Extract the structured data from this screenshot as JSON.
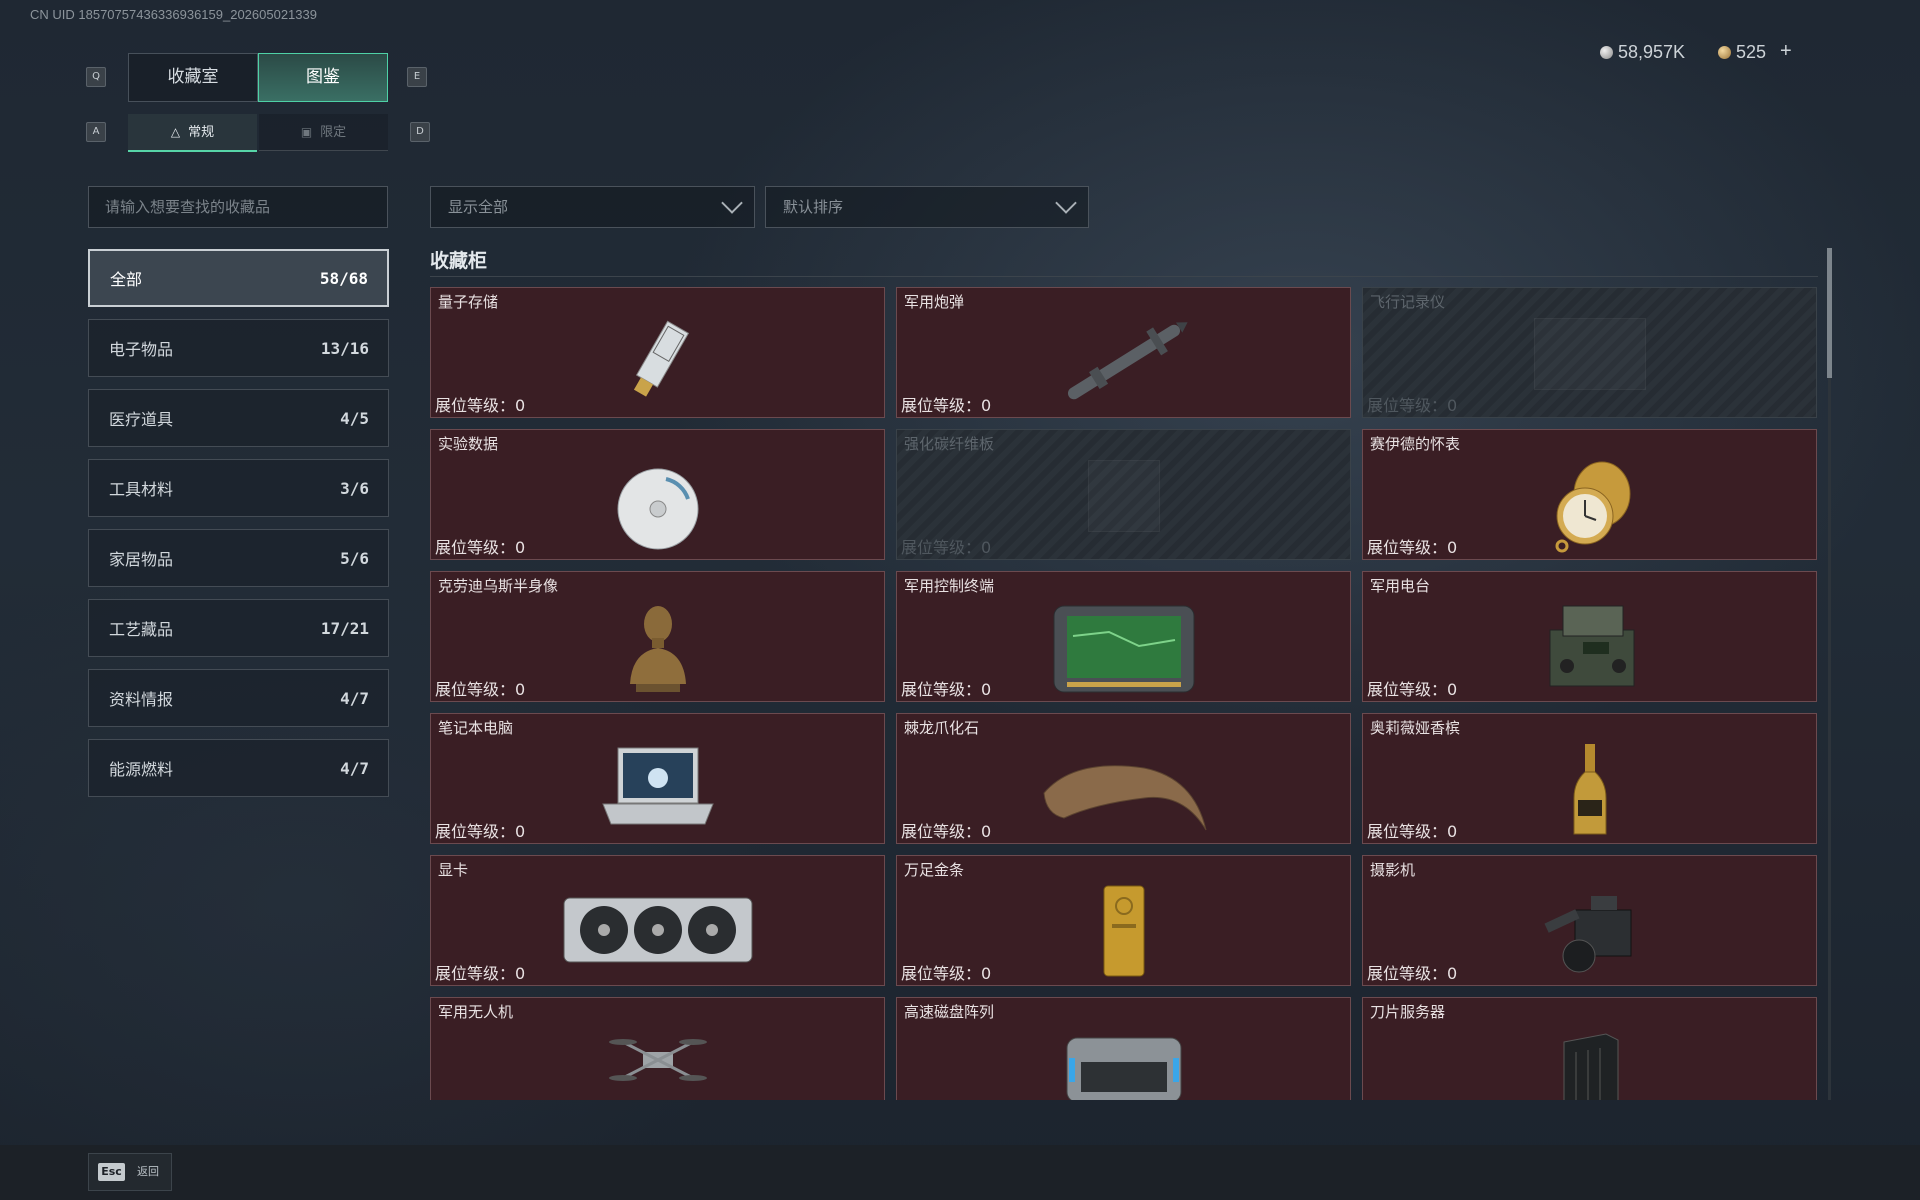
{
  "watermark": {
    "uid": "CN UID 18570757436336936159_202605021339"
  },
  "keys": {
    "prev_tab": "Q",
    "next_tab": "E",
    "prev_sub": "A",
    "next_sub": "D"
  },
  "main_tabs": [
    {
      "label": "收藏室"
    },
    {
      "label": "图鉴"
    }
  ],
  "sub_tabs": [
    {
      "label": "常规",
      "icon": "bottle-icon"
    },
    {
      "label": "限定",
      "icon": "image-icon"
    }
  ],
  "currency": {
    "silver": {
      "value": "58,957K",
      "color": "#c9c9c9"
    },
    "gold": {
      "value": "525",
      "color": "#c8a46a"
    },
    "add_label": "+"
  },
  "search": {
    "placeholder": "请输入想要查找的收藏品"
  },
  "filters": {
    "display": "显示全部",
    "sort": "默认排序"
  },
  "categories": [
    {
      "label": "全部",
      "count": "58/68"
    },
    {
      "label": "电子物品",
      "count": "13/16"
    },
    {
      "label": "医疗道具",
      "count": "4/5"
    },
    {
      "label": "工具材料",
      "count": "3/6"
    },
    {
      "label": "家居物品",
      "count": "5/6"
    },
    {
      "label": "工艺藏品",
      "count": "17/21"
    },
    {
      "label": "资料情报",
      "count": "4/7"
    },
    {
      "label": "能源燃料",
      "count": "4/7"
    }
  ],
  "section_title": "收藏柜",
  "level_label": "展位等级：0",
  "items": [
    {
      "name": "量子存储",
      "locked": false,
      "icon": "usb-drive-icon"
    },
    {
      "name": "军用炮弹",
      "locked": false,
      "icon": "missile-icon"
    },
    {
      "name": "飞行记录仪",
      "locked": true,
      "icon": "flight-recorder-icon"
    },
    {
      "name": "实验数据",
      "locked": false,
      "icon": "disc-icon"
    },
    {
      "name": "强化碳纤维板",
      "locked": true,
      "icon": "carbon-plate-icon"
    },
    {
      "name": "赛伊德的怀表",
      "locked": false,
      "icon": "pocket-watch-icon"
    },
    {
      "name": "克劳迪乌斯半身像",
      "locked": false,
      "icon": "bust-icon"
    },
    {
      "name": "军用控制终端",
      "locked": false,
      "icon": "terminal-icon"
    },
    {
      "name": "军用电台",
      "locked": false,
      "icon": "radio-icon"
    },
    {
      "name": "笔记本电脑",
      "locked": false,
      "icon": "laptop-icon"
    },
    {
      "name": "棘龙爪化石",
      "locked": false,
      "icon": "claw-fossil-icon"
    },
    {
      "name": "奥莉薇娅香槟",
      "locked": false,
      "icon": "champagne-icon"
    },
    {
      "name": "显卡",
      "locked": false,
      "icon": "graphics-card-icon"
    },
    {
      "name": "万足金条",
      "locked": false,
      "icon": "gold-bar-icon"
    },
    {
      "name": "摄影机",
      "locked": false,
      "icon": "camera-icon"
    },
    {
      "name": "军用无人机",
      "locked": false,
      "icon": "drone-icon"
    },
    {
      "name": "高速磁盘阵列",
      "locked": false,
      "icon": "disk-array-icon"
    },
    {
      "name": "刀片服务器",
      "locked": false,
      "icon": "blade-server-icon"
    }
  ],
  "footer": {
    "esc_key": "Esc",
    "esc_label": "返回"
  }
}
